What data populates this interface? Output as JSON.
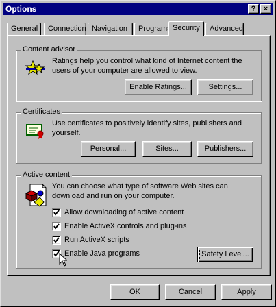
{
  "window": {
    "title": "Options",
    "help_glyph": "?",
    "close_glyph": "×"
  },
  "tabs": [
    {
      "label": "General"
    },
    {
      "label": "Connection"
    },
    {
      "label": "Navigation"
    },
    {
      "label": "Programs"
    },
    {
      "label": "Security"
    },
    {
      "label": "Advanced"
    }
  ],
  "active_tab": "Security",
  "content_advisor": {
    "title": "Content advisor",
    "description": "Ratings help you control what kind of Internet content the users of your computer are allowed to view.",
    "enable_ratings_label": "Enable Ratings...",
    "settings_label": "Settings..."
  },
  "certificates": {
    "title": "Certificates",
    "description": "Use certificates to positively identify sites, publishers and yourself.",
    "personal_label": "Personal...",
    "sites_label": "Sites...",
    "publishers_label": "Publishers..."
  },
  "active_content": {
    "title": "Active content",
    "description": "You can choose what type of software Web sites can download and run on your computer.",
    "options": [
      {
        "label": "Allow downloading of active content",
        "checked": true
      },
      {
        "label": "Enable ActiveX controls and plug-ins",
        "checked": true
      },
      {
        "label": "Run ActiveX scripts",
        "checked": true
      },
      {
        "label": "Enable Java programs",
        "checked": true
      }
    ],
    "safety_level_label": "Safety Level..."
  },
  "footer": {
    "ok_label": "OK",
    "cancel_label": "Cancel",
    "apply_label": "Apply"
  }
}
